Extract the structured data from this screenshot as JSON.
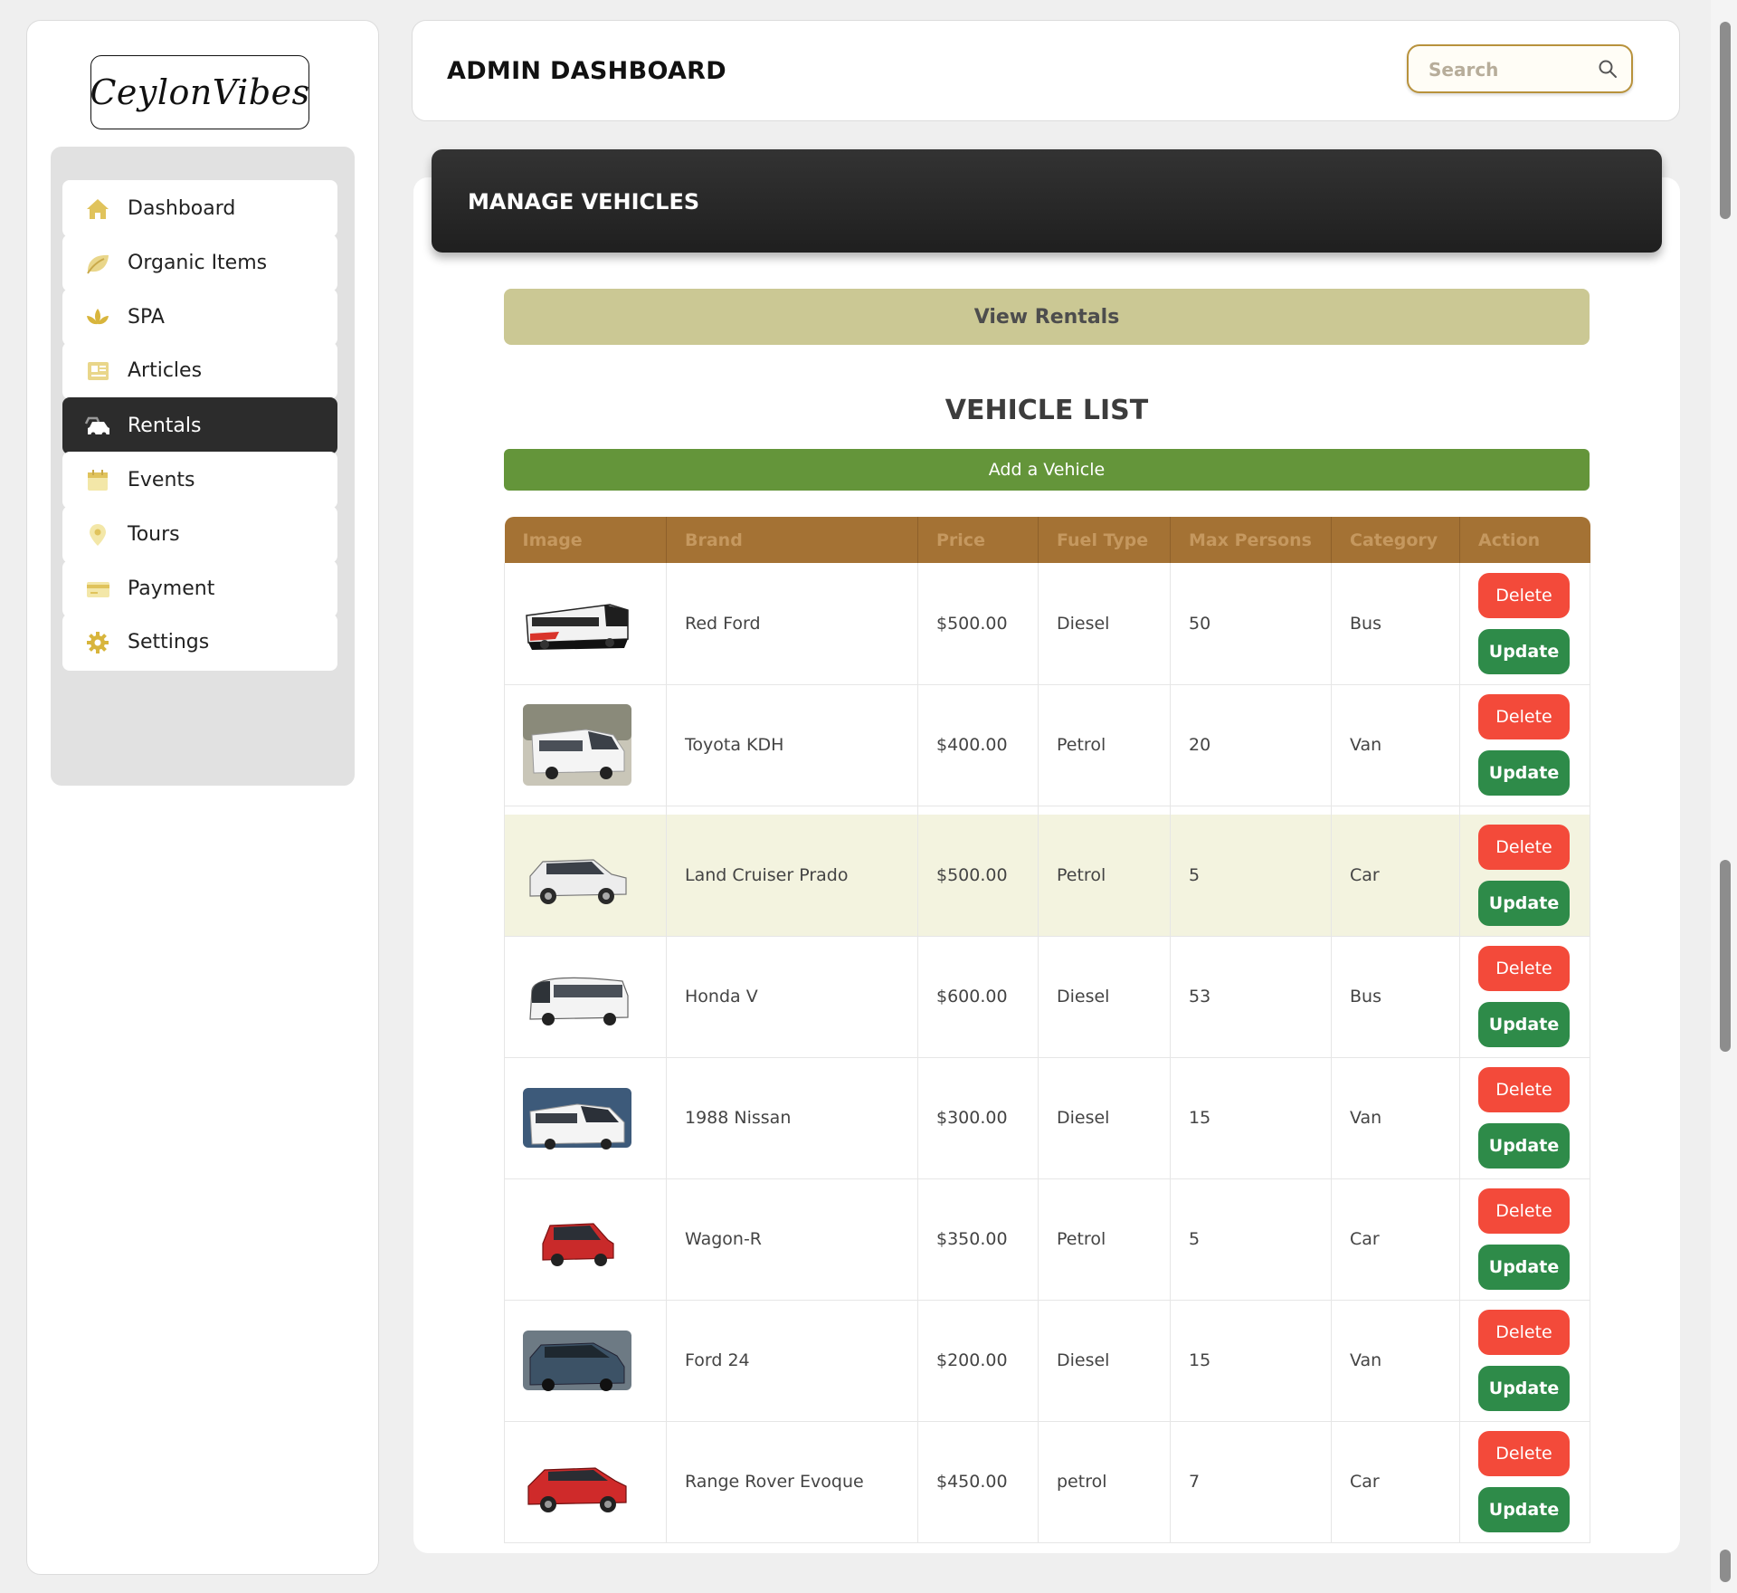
{
  "app": {
    "logo_text": "CeylonVibes",
    "header_title": "ADMIN DASHBOARD",
    "search_placeholder": "Search"
  },
  "sidebar": {
    "items": [
      {
        "label": "Dashboard",
        "icon": "home-icon",
        "active": false
      },
      {
        "label": "Organic Items",
        "icon": "leaf-icon",
        "active": false
      },
      {
        "label": "SPA",
        "icon": "lotus-icon",
        "active": false
      },
      {
        "label": "Articles",
        "icon": "newspaper-icon",
        "active": false
      },
      {
        "label": "Rentals",
        "icon": "car-icon",
        "active": true
      },
      {
        "label": "Events",
        "icon": "calendar-icon",
        "active": false
      },
      {
        "label": "Tours",
        "icon": "map-pin-icon",
        "active": false
      },
      {
        "label": "Payment",
        "icon": "credit-card-icon",
        "active": false
      },
      {
        "label": "Settings",
        "icon": "gear-icon",
        "active": false
      }
    ]
  },
  "main": {
    "banner_title": "MANAGE VEHICLES",
    "view_rentals_label": "View Rentals",
    "list_title": "VEHICLE LIST",
    "add_vehicle_label": "Add a Vehicle",
    "delete_label": "Delete",
    "update_label": "Update",
    "columns": [
      "Image",
      "Brand",
      "Price",
      "Fuel Type",
      "Max Persons",
      "Category",
      "Action"
    ],
    "rows": [
      {
        "brand": "Red Ford",
        "price": "$500.00",
        "fuel": "Diesel",
        "max_persons": "50",
        "category": "Bus",
        "image": "bus-image"
      },
      {
        "brand": "Toyota KDH",
        "price": "$400.00",
        "fuel": "Petrol",
        "max_persons": "20",
        "category": "Van",
        "image": "van-image"
      },
      {
        "brand": "Land Cruiser Prado",
        "price": "$500.00",
        "fuel": "Petrol",
        "max_persons": "5",
        "category": "Car",
        "image": "suv-image"
      },
      {
        "brand": "Honda V",
        "price": "$600.00",
        "fuel": "Diesel",
        "max_persons": "53",
        "category": "Bus",
        "image": "coach-image"
      },
      {
        "brand": "1988 Nissan",
        "price": "$300.00",
        "fuel": "Diesel",
        "max_persons": "15",
        "category": "Van",
        "image": "van-image"
      },
      {
        "brand": "Wagon-R",
        "price": "$350.00",
        "fuel": "Petrol",
        "max_persons": "5",
        "category": "Car",
        "image": "small-car-image"
      },
      {
        "brand": "Ford 24",
        "price": "$200.00",
        "fuel": "Diesel",
        "max_persons": "15",
        "category": "Van",
        "image": "van-image"
      },
      {
        "brand": "Range Rover Evoque",
        "price": "$450.00",
        "fuel": "petrol",
        "max_persons": "7",
        "category": "Car",
        "image": "red-suv-image"
      }
    ]
  },
  "colors": {
    "accent_gold": "#b8923c",
    "table_header": "#a47234",
    "view_rentals_bg": "#cbc894",
    "add_vehicle_bg": "#64953a",
    "delete_bg": "#f34a3a",
    "update_bg": "#2e8b49",
    "active_nav_bg": "#2c2c2c",
    "highlight_row": "#f3f3df"
  }
}
